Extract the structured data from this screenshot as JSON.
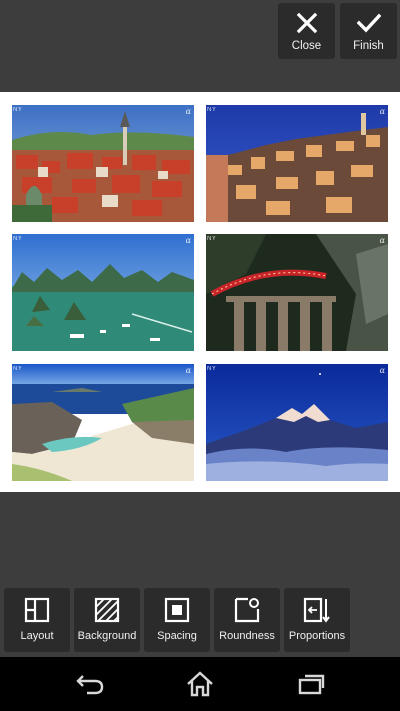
{
  "header": {
    "close_label": "Close",
    "finish_label": "Finish"
  },
  "collage": {
    "photos": [
      {
        "subject": "town-with-red-roofs-and-church-spire",
        "watermark": "α",
        "brand": "NY"
      },
      {
        "subject": "hillside-stone-city-at-dusk",
        "watermark": "α",
        "brand": "NY"
      },
      {
        "subject": "bay-with-limestone-islands-and-boats",
        "watermark": "α",
        "brand": "NY"
      },
      {
        "subject": "red-train-crossing-stone-viaduct",
        "watermark": "α",
        "brand": "NY"
      },
      {
        "subject": "rocky-coast-with-sandy-beach",
        "watermark": "α",
        "brand": "NY"
      },
      {
        "subject": "snowy-mountain-peaks-at-night",
        "watermark": "α",
        "brand": "NY"
      }
    ],
    "background_color": "#ffffff"
  },
  "toolbar": {
    "items": [
      {
        "label": "Layout",
        "icon": "layout-icon"
      },
      {
        "label": "Background",
        "icon": "background-icon"
      },
      {
        "label": "Spacing",
        "icon": "spacing-icon"
      },
      {
        "label": "Roundness",
        "icon": "roundness-icon"
      },
      {
        "label": "Proportions",
        "icon": "proportions-icon"
      }
    ]
  },
  "navbar": {
    "buttons": [
      "back-icon",
      "home-icon",
      "recent-apps-icon"
    ]
  },
  "colors": {
    "app_background": "#3d3d3d",
    "button_background": "#2b2b2b",
    "navbar": "#000000"
  }
}
